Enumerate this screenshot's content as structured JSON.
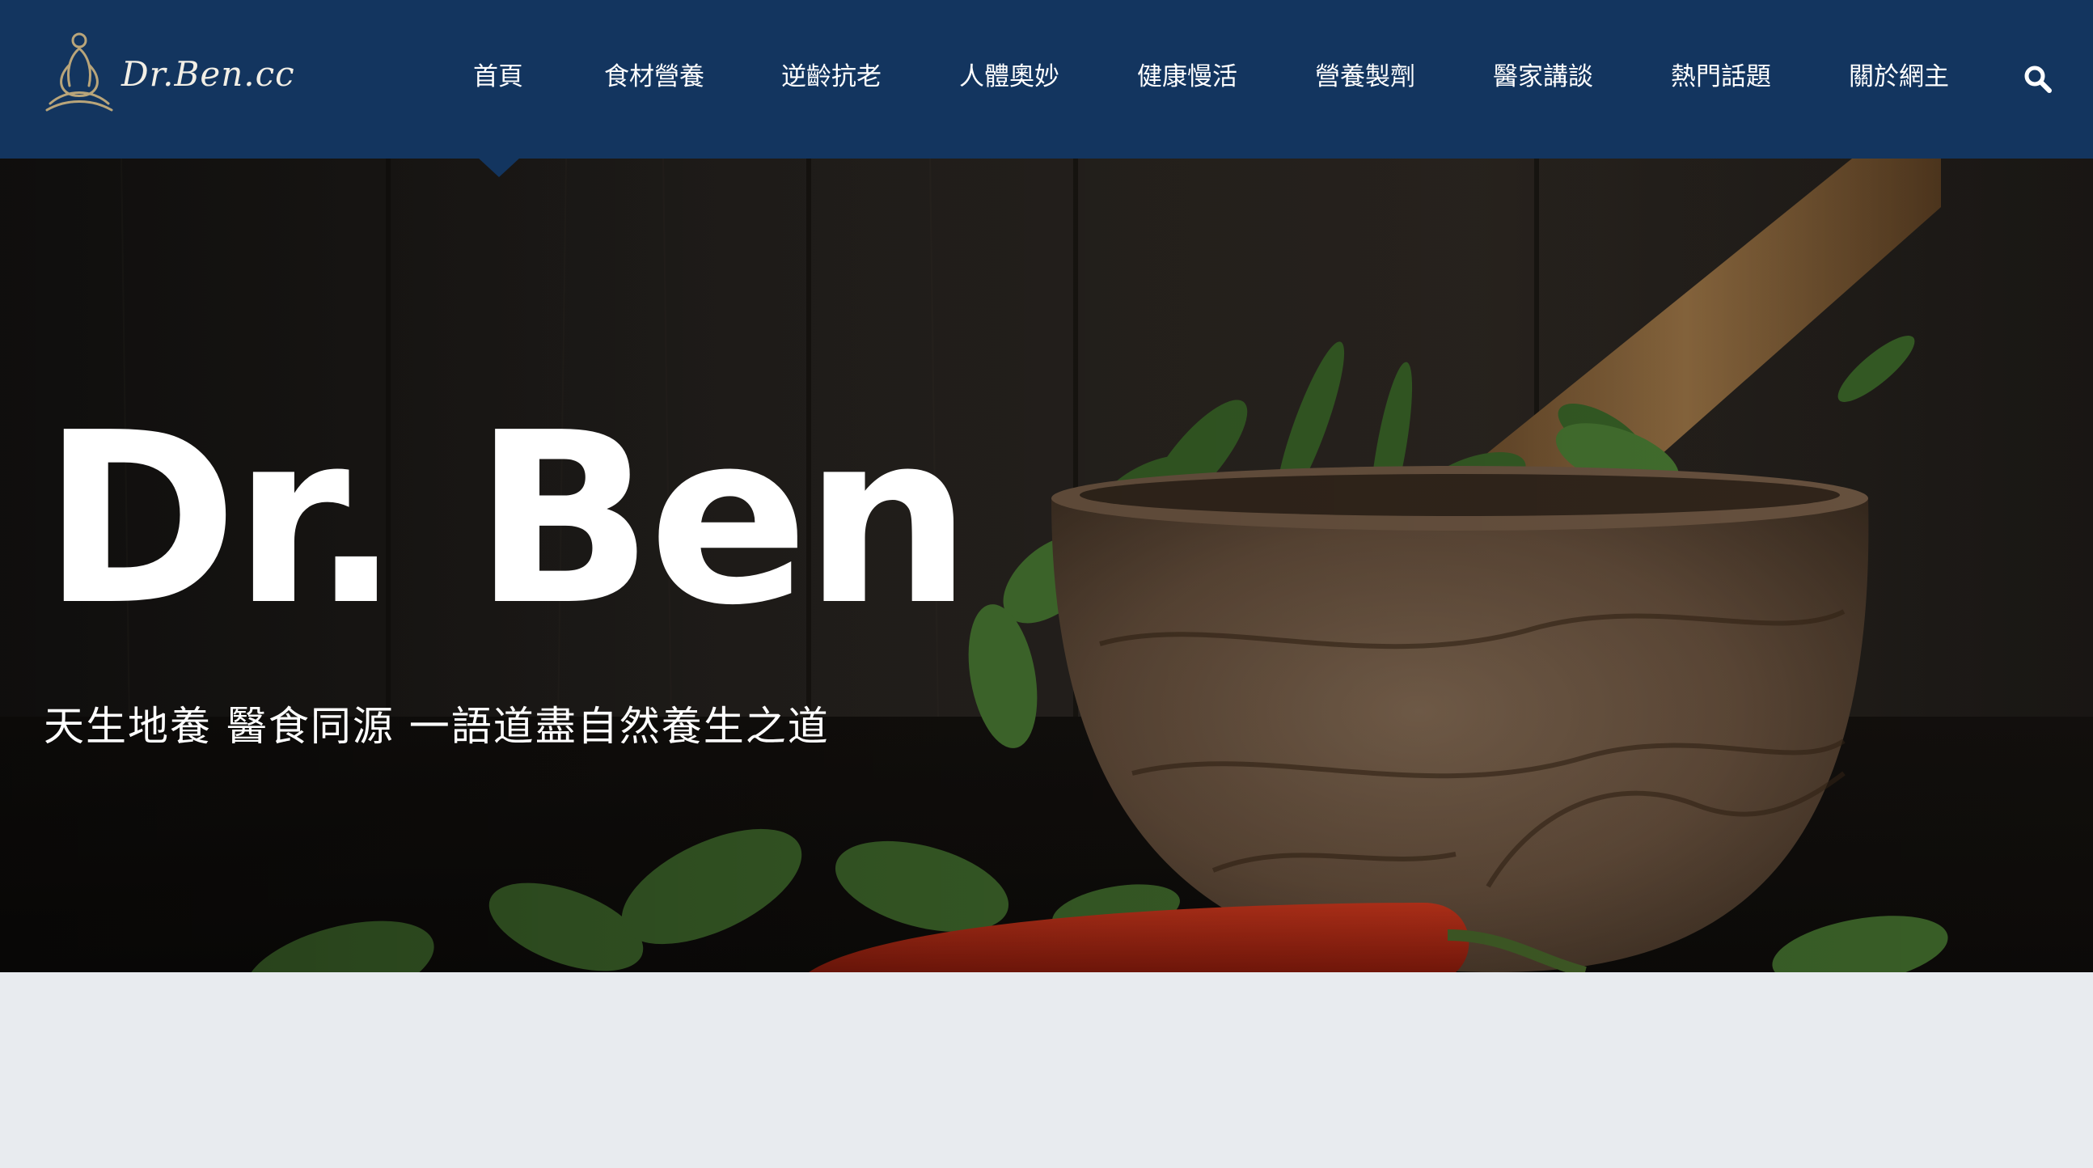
{
  "site": {
    "logo_text": "Dr.Ben.cc"
  },
  "nav": {
    "items": [
      {
        "label": "首頁",
        "active": true
      },
      {
        "label": "食材營養"
      },
      {
        "label": "逆齡抗老"
      },
      {
        "label": "人體奧妙"
      },
      {
        "label": "健康慢活"
      },
      {
        "label": "營養製劑"
      },
      {
        "label": "醫家講談"
      },
      {
        "label": "熱門話題"
      },
      {
        "label": "關於網主"
      }
    ],
    "search_icon": "search-icon"
  },
  "hero": {
    "title": "Dr. Ben",
    "subtitle": "天生地養 醫食同源 一語道盡自然養生之道"
  },
  "colors": {
    "navbar": "#13355f",
    "page_bg": "#e8ebef",
    "text_light": "#ffffff"
  }
}
